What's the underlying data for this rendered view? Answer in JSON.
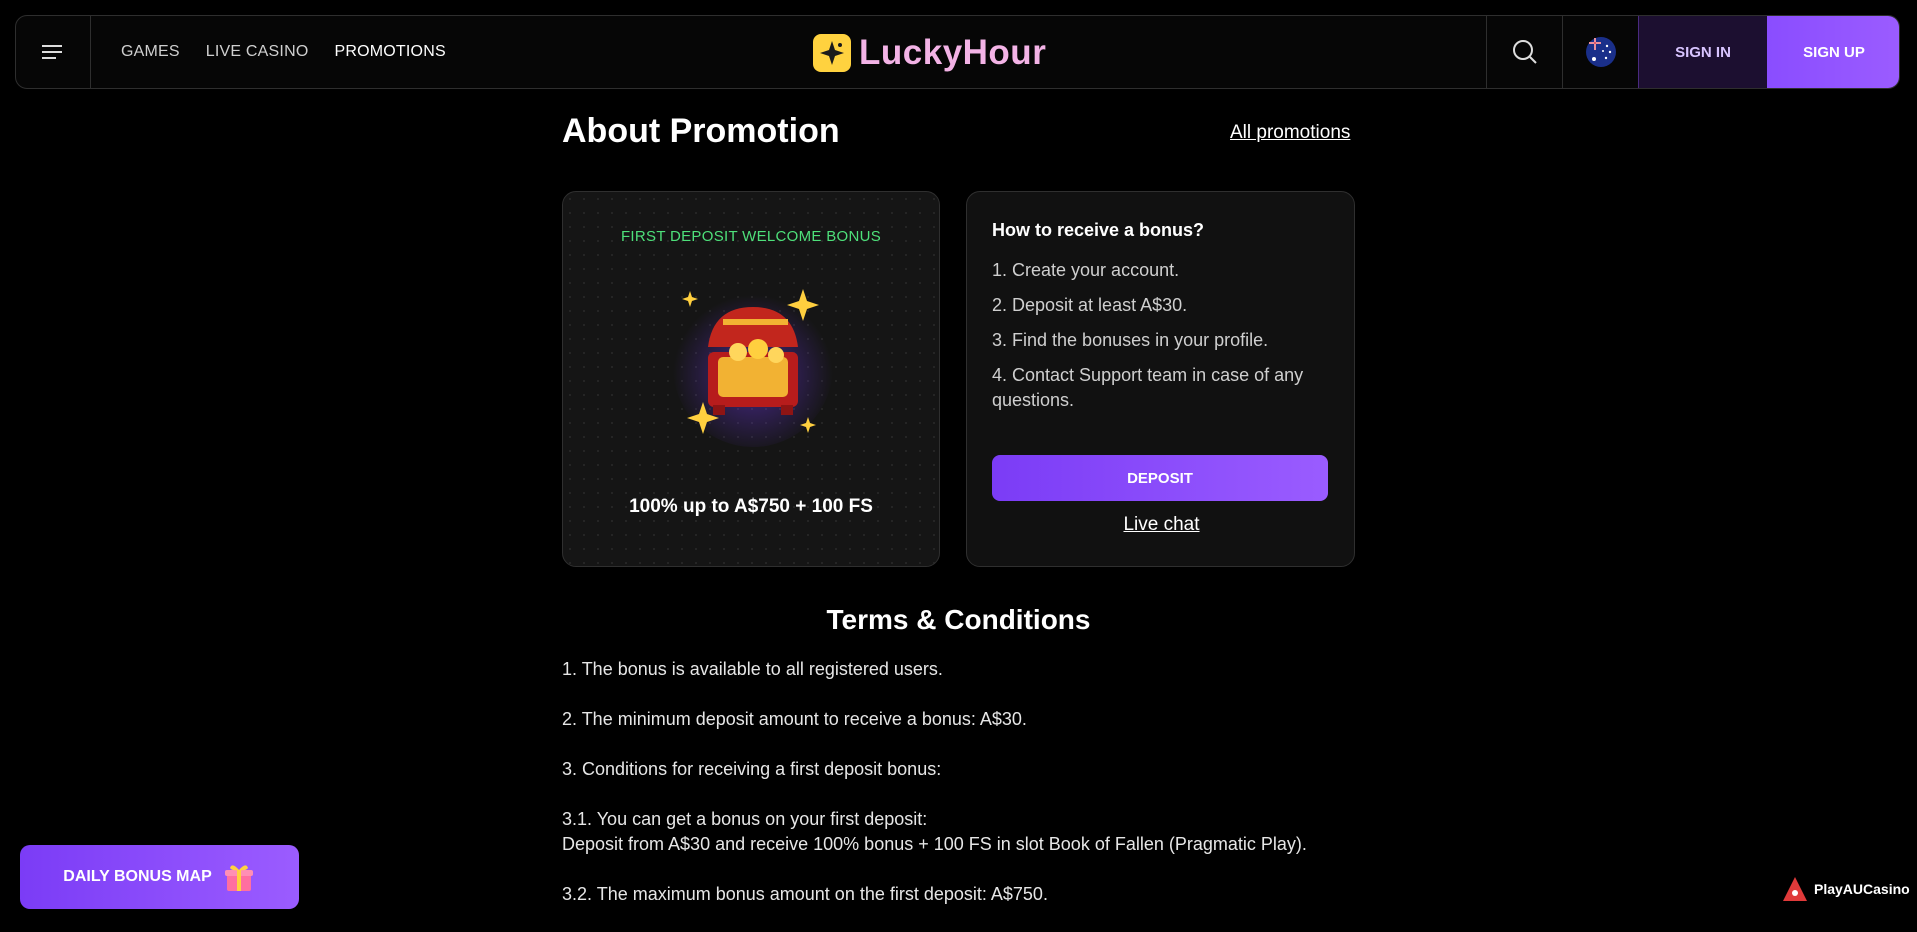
{
  "header": {
    "nav": [
      "GAMES",
      "LIVE CASINO",
      "PROMOTIONS"
    ],
    "logo_text": "LuckyHour",
    "sign_in": "SIGN IN",
    "sign_up": "SIGN UP"
  },
  "main": {
    "title": "About Promotion",
    "all_promotions": "All promotions",
    "promo": {
      "label": "FIRST DEPOSIT WELCOME BONUS",
      "amount": "100% up to A$750 + 100 FS"
    },
    "howto": {
      "title": "How to receive a bonus?",
      "steps": [
        "1. Create your account.",
        "2. Deposit at least A$30.",
        "3. Find the bonuses in your profile.",
        "4. Contact Support team in case of any questions."
      ],
      "deposit": "DEPOSIT",
      "live_chat": "Live chat"
    },
    "terms": {
      "title": "Terms & Conditions",
      "items": [
        "1. The bonus is available to all registered users.",
        "2. The minimum deposit amount to receive a bonus: A$30.",
        "3. Conditions for receiving a first deposit bonus:",
        "3.1. You can get a bonus on your first deposit:",
        "Deposit from A$30 and receive 100% bonus + 100 FS in slot Book of Fallen (Pragmatic Play).",
        "3.2. The maximum bonus amount on the first deposit: A$750."
      ]
    }
  },
  "floating": {
    "daily_bonus": "DAILY BONUS MAP",
    "watermark": "PlayAUCasino"
  },
  "colors": {
    "accent": "#8a4dff",
    "promo_label": "#4ee07a",
    "logo": "#f3b3e6",
    "logo_badge": "#ffd23f"
  }
}
